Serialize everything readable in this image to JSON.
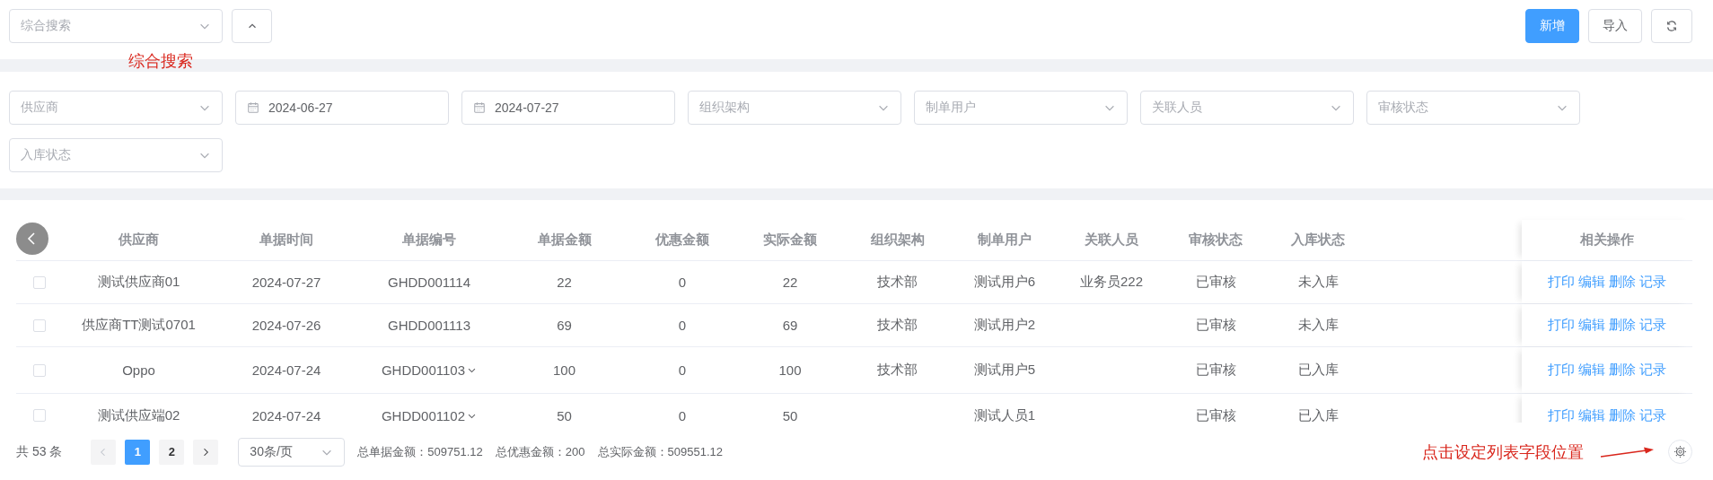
{
  "toolbar": {
    "search_select": {
      "placeholder": "综合搜索"
    },
    "buttons": [
      {
        "label": "新增",
        "kind": "primary"
      },
      {
        "label": "导入",
        "kind": "default"
      }
    ],
    "annotation": "综合搜索"
  },
  "filters": [
    {
      "kind": "select",
      "placeholder": "供应商"
    },
    {
      "kind": "date",
      "value": "2024-06-27"
    },
    {
      "kind": "date",
      "value": "2024-07-27"
    },
    {
      "kind": "select",
      "placeholder": "组织架构"
    },
    {
      "kind": "select",
      "placeholder": "制单用户"
    },
    {
      "kind": "select",
      "placeholder": "关联人员"
    },
    {
      "kind": "select",
      "placeholder": "审核状态"
    },
    {
      "kind": "select",
      "placeholder": "入库状态"
    }
  ],
  "table": {
    "columns": [
      "供应商",
      "单据时间",
      "单据编号",
      "单据金额",
      "优惠金额",
      "实际金额",
      "组织架构",
      "制单用户",
      "关联人员",
      "审核状态",
      "入库状态"
    ],
    "actions_column": "相关操作",
    "rows": [
      {
        "checked": false,
        "expandable": false,
        "cells": [
          "测试供应商01",
          "2024-07-27",
          "GHDD001114",
          "22",
          "0",
          "22",
          "技术部",
          "测试用户6",
          "业务员222",
          "已审核",
          "未入库"
        ],
        "actions": [
          "打印",
          "编辑",
          "删除",
          "记录"
        ]
      },
      {
        "checked": false,
        "expandable": false,
        "cells": [
          "供应商TT测试0701",
          "2024-07-26",
          "GHDD001113",
          "69",
          "0",
          "69",
          "技术部",
          "测试用户2",
          null,
          "已审核",
          "未入库"
        ],
        "actions": [
          "打印",
          "编辑",
          "删除",
          "记录"
        ]
      },
      {
        "checked": false,
        "expandable": true,
        "cells": [
          "Oppo",
          "2024-07-24",
          "GHDD001103",
          "100",
          "0",
          "100",
          "技术部",
          "测试用户5",
          null,
          "已审核",
          "已入库"
        ],
        "actions": [
          "打印",
          "编辑",
          "删除",
          "记录"
        ]
      },
      {
        "checked": false,
        "expandable": true,
        "cells": [
          "测试供应端02",
          "2024-07-24",
          "GHDD001102",
          "50",
          "0",
          "50",
          null,
          "测试人员1",
          null,
          "已审核",
          "已入库"
        ],
        "actions": [
          "打印",
          "编辑",
          "删除",
          "记录"
        ]
      }
    ]
  },
  "pagination": {
    "total": "共 53 条",
    "pages": [
      {
        "label": "1",
        "selected": true
      },
      {
        "label": "2",
        "selected": false
      }
    ],
    "page_size": "30条/页",
    "totals": [
      "总单据金额：509751.12",
      "总优惠金额：200",
      "总实际金额：509551.12"
    ],
    "annotation": "点击设定列表字段位置"
  }
}
